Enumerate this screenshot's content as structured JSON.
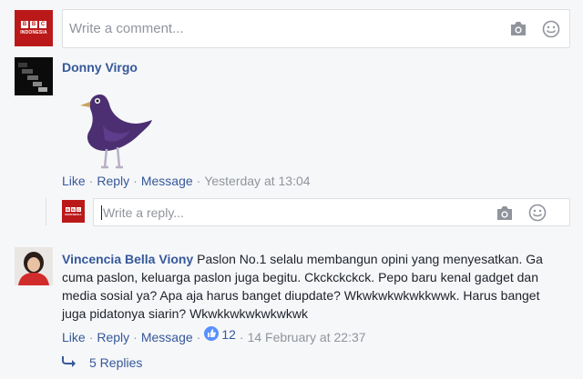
{
  "top_composer": {
    "placeholder": "Write a comment...",
    "logo": {
      "box_letters": [
        "B",
        "B",
        "C"
      ],
      "subtitle": "INDONESIA"
    }
  },
  "comments": [
    {
      "author": "Donny Virgo",
      "text": "",
      "sticker": "purple-pigeon-sticker",
      "actions": {
        "like": "Like",
        "reply": "Reply",
        "message": "Message",
        "time": "Yesterday at 13:04"
      }
    },
    {
      "author": "Vincencia Bella Viony",
      "text": "Paslon No.1 selalu membangun opini yang menyesatkan. Ga cuma paslon, keluarga paslon juga begitu. Ckckckckck. Pepo baru kenal gadget dan media sosial ya? Apa aja harus banget diupdate? Wkwkwkwkwkkwwk. Harus banget juga pidatonya siarin? Wkwkkwkwkwkwkwk",
      "actions": {
        "like": "Like",
        "reply": "Reply",
        "message": "Message",
        "likes_count": "12",
        "time": "14 February at 22:37"
      },
      "replies_label": "5 Replies"
    }
  ],
  "reply_composer": {
    "placeholder": "Write a reply..."
  },
  "colors": {
    "link": "#365899",
    "meta": "#90949c",
    "background": "#f6f7f9",
    "like_blue": "#5890ff",
    "bbc_red": "#bb1919"
  },
  "icons": [
    "camera-icon",
    "smiley-icon",
    "like-thumb-icon",
    "reply-arrow-icon"
  ]
}
